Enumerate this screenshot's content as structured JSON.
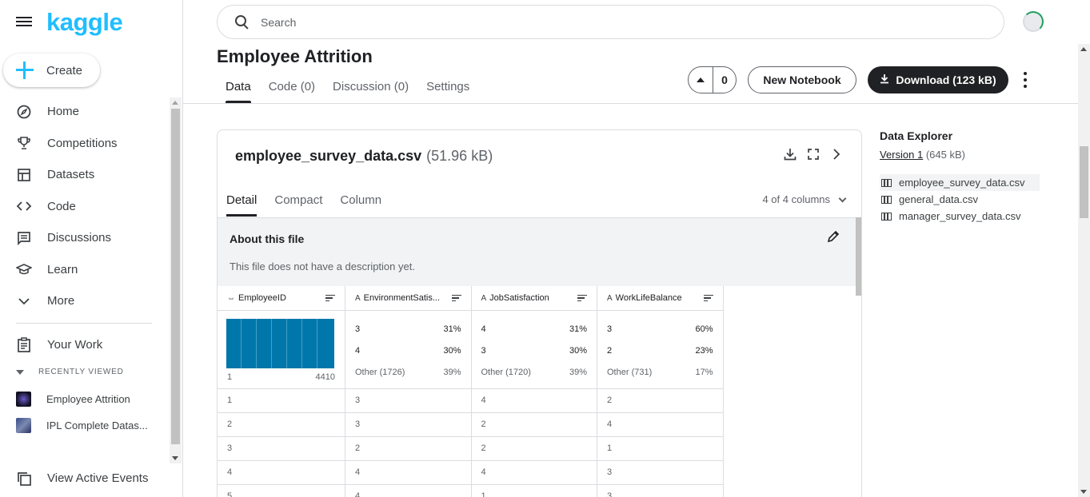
{
  "brand": {
    "logo": "kaggle"
  },
  "sidebar": {
    "create_label": "Create",
    "items": [
      {
        "label": "Home",
        "icon": "compass-icon"
      },
      {
        "label": "Competitions",
        "icon": "trophy-icon"
      },
      {
        "label": "Datasets",
        "icon": "table-icon"
      },
      {
        "label": "Code",
        "icon": "code-icon"
      },
      {
        "label": "Discussions",
        "icon": "comment-icon"
      },
      {
        "label": "Learn",
        "icon": "school-icon"
      },
      {
        "label": "More",
        "icon": "chevron-down-icon"
      }
    ],
    "your_work": "Your Work",
    "recently_viewed_header": "RECENTLY VIEWED",
    "recent": [
      {
        "label": "Employee Attrition"
      },
      {
        "label": "IPL Complete Datas..."
      }
    ],
    "view_active_events": "View Active Events"
  },
  "search": {
    "placeholder": "Search"
  },
  "dataset": {
    "title": "Employee Attrition",
    "tabs": [
      "Data",
      "Code (0)",
      "Discussion (0)",
      "Settings"
    ],
    "active_tab": "Data",
    "vote_count": "0",
    "new_notebook_label": "New Notebook",
    "download_label": "Download (123 kB)"
  },
  "file": {
    "name": "employee_survey_data.csv",
    "size": "(51.96 kB)",
    "subtabs": [
      "Detail",
      "Compact",
      "Column"
    ],
    "columns_selector": "4 of 4 columns",
    "about_title": "About this file",
    "about_text": "This file does not have a description yet."
  },
  "table": {
    "headers": [
      {
        "name": "EmployeeID",
        "type": "⇔"
      },
      {
        "name": "EnvironmentSatis...",
        "type": "A"
      },
      {
        "name": "JobSatisfaction",
        "type": "A"
      },
      {
        "name": "WorkLifeBalance",
        "type": "A"
      }
    ],
    "histogram": {
      "min": "1",
      "max": "4410"
    },
    "summaries": [
      [
        {
          "k": "3",
          "v": "31%"
        },
        {
          "k": "4",
          "v": "30%"
        },
        {
          "k": "Other (1726)",
          "v": "39%"
        }
      ],
      [
        {
          "k": "4",
          "v": "31%"
        },
        {
          "k": "3",
          "v": "30%"
        },
        {
          "k": "Other (1720)",
          "v": "39%"
        }
      ],
      [
        {
          "k": "3",
          "v": "60%"
        },
        {
          "k": "2",
          "v": "23%"
        },
        {
          "k": "Other (731)",
          "v": "17%"
        }
      ]
    ],
    "rows": [
      [
        "1",
        "3",
        "4",
        "2"
      ],
      [
        "2",
        "3",
        "2",
        "4"
      ],
      [
        "3",
        "2",
        "2",
        "1"
      ],
      [
        "4",
        "4",
        "4",
        "3"
      ],
      [
        "5",
        "4",
        "1",
        "3"
      ]
    ]
  },
  "explorer": {
    "title": "Data Explorer",
    "version_link": "Version 1",
    "version_size": "(645 kB)",
    "files": [
      "employee_survey_data.csv",
      "general_data.csv",
      "manager_survey_data.csv"
    ],
    "selected_file": "employee_survey_data.csv"
  },
  "colors": {
    "brand": "#20beff",
    "histogram": "#0077aa",
    "dark_button": "#202124"
  }
}
